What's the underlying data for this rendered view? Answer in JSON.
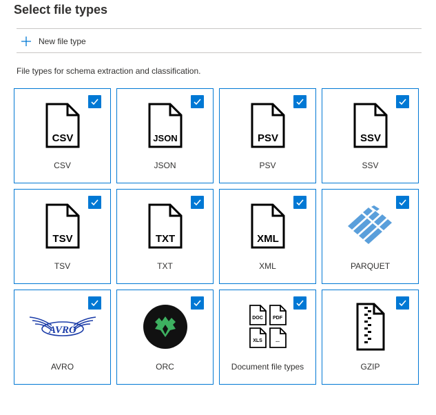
{
  "page": {
    "title": "Select file types",
    "description": "File types for schema extraction and classification."
  },
  "toolbar": {
    "new_label": "New file type"
  },
  "colors": {
    "accent": "#0078d4",
    "border": "#c8c6c4",
    "text": "#323130"
  },
  "tiles": [
    {
      "label": "CSV",
      "icon": "csv-file-icon",
      "icon_text": "CSV",
      "checked": true
    },
    {
      "label": "JSON",
      "icon": "json-file-icon",
      "icon_text": "JSON",
      "checked": true
    },
    {
      "label": "PSV",
      "icon": "psv-file-icon",
      "icon_text": "PSV",
      "checked": true
    },
    {
      "label": "SSV",
      "icon": "ssv-file-icon",
      "icon_text": "SSV",
      "checked": true
    },
    {
      "label": "TSV",
      "icon": "tsv-file-icon",
      "icon_text": "TSV",
      "checked": true
    },
    {
      "label": "TXT",
      "icon": "txt-file-icon",
      "icon_text": "TXT",
      "checked": true
    },
    {
      "label": "XML",
      "icon": "xml-file-icon",
      "icon_text": "XML",
      "checked": true
    },
    {
      "label": "PARQUET",
      "icon": "parquet-logo-icon",
      "checked": true
    },
    {
      "label": "AVRO",
      "icon": "avro-logo-icon",
      "icon_text": "AVRO",
      "checked": true
    },
    {
      "label": "ORC",
      "icon": "orc-logo-icon",
      "checked": true
    },
    {
      "label": "Document file types",
      "icon": "document-files-icon",
      "doc_icons": [
        "DOC",
        "PDF",
        "XLS",
        "..."
      ],
      "checked": true
    },
    {
      "label": "GZIP",
      "icon": "zip-file-icon",
      "checked": true
    }
  ]
}
